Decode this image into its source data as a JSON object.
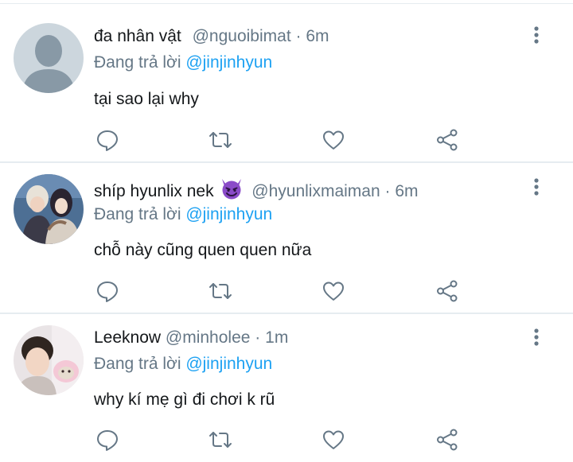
{
  "tweets": [
    {
      "name": "đa nhân vật",
      "handle": "@nguoibimat",
      "separator": "·",
      "time": "6m",
      "reply_prefix": "Đang trả lời",
      "reply_to": "@jinjinhyun",
      "text": "tại sao lại why",
      "avatar": "default-avatar",
      "has_emoji": false
    },
    {
      "name": "shíp hyunlix nek",
      "emoji": "smiling-imp-emoji",
      "handle": "@hyunlixmaiman",
      "separator": "·",
      "time": "6m",
      "reply_prefix": "Đang trả lời",
      "reply_to": "@jinjinhyun",
      "text": "chỗ này cũng quen quen nữa",
      "avatar": "photo-avatar",
      "has_emoji": true
    },
    {
      "name": "Leeknow",
      "handle": "@minholee",
      "separator": "·",
      "time": "1m",
      "reply_prefix": "Đang trả lời",
      "reply_to": "@jinjinhyun",
      "text": "why kí mẹ gì đi chơi k rũ",
      "avatar": "photo-avatar",
      "has_emoji": false
    }
  ],
  "action_icons": [
    "reply-icon",
    "retweet-icon",
    "like-icon",
    "share-icon"
  ],
  "menu_icon": "more-vertical-icon",
  "colors": {
    "text": "#14171a",
    "secondary": "#657786",
    "link": "#1da1f2",
    "divider": "#e6ecf0",
    "icon": "#657786"
  }
}
